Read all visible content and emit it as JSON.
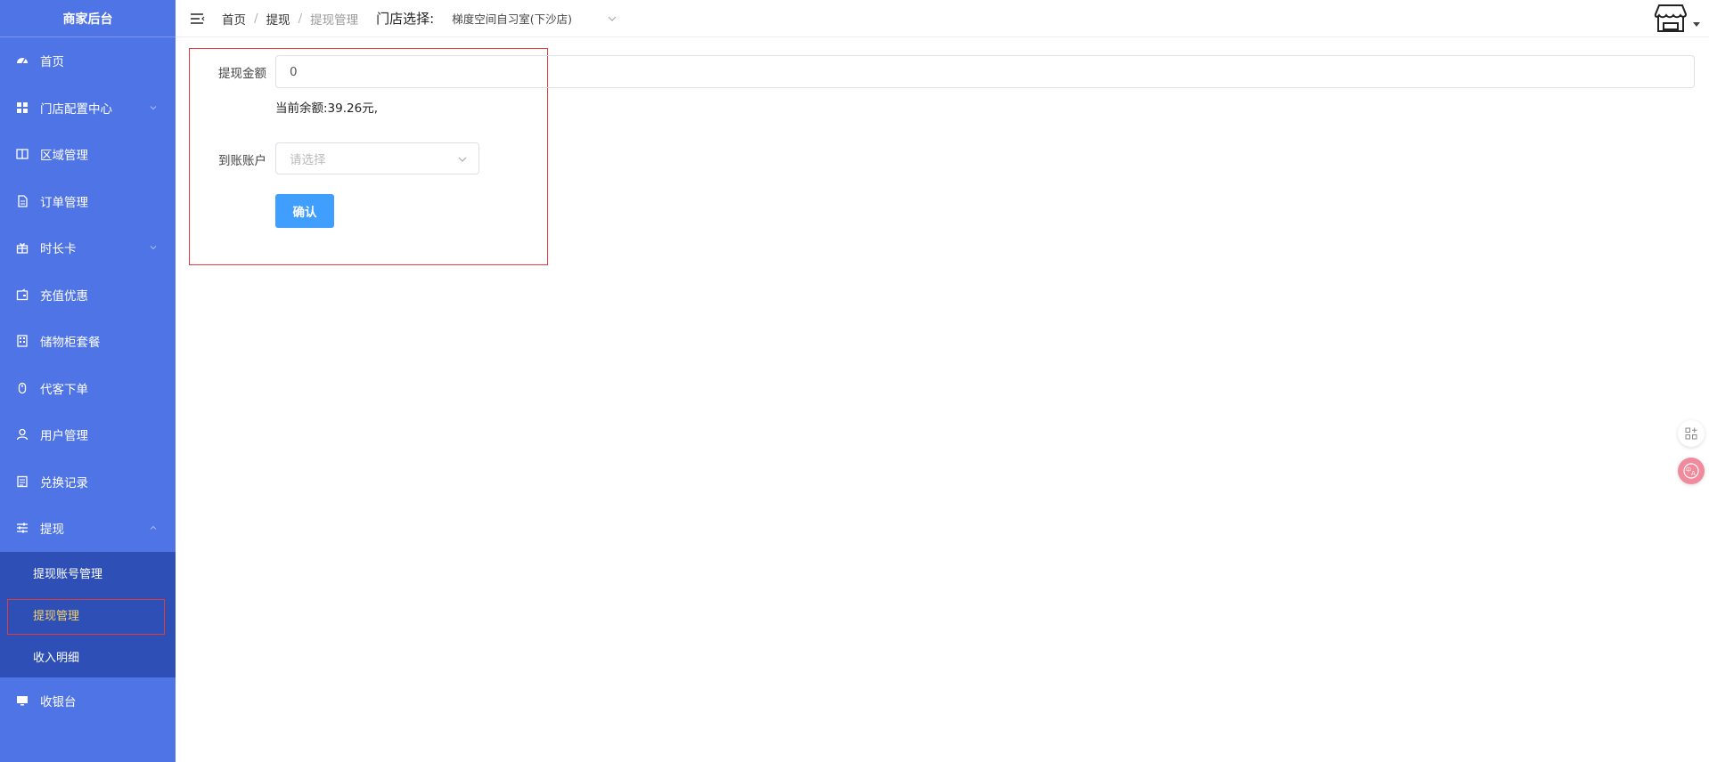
{
  "sidebar": {
    "brand": "商家后台",
    "items": [
      {
        "label": "首页"
      },
      {
        "label": "门店配置中心"
      },
      {
        "label": "区域管理"
      },
      {
        "label": "订单管理"
      },
      {
        "label": "时长卡"
      },
      {
        "label": "充值优惠"
      },
      {
        "label": "储物柜套餐"
      },
      {
        "label": "代客下单"
      },
      {
        "label": "用户管理"
      },
      {
        "label": "兑换记录"
      },
      {
        "label": "提现"
      },
      {
        "label": "收银台"
      }
    ],
    "submenu": [
      {
        "label": "提现账号管理"
      },
      {
        "label": "提现管理"
      },
      {
        "label": "收入明细"
      }
    ]
  },
  "header": {
    "breadcrumb": [
      "首页",
      "提现",
      "提现管理"
    ],
    "separator": "/",
    "store_label": "门店选择:",
    "store_value": "梯度空间自习室(下沙店)"
  },
  "form": {
    "amount_label": "提现金额",
    "amount_value": "0",
    "balance_text": "当前余额:39.26元,",
    "account_label": "到账账户",
    "account_placeholder": "请选择",
    "confirm_label": "确认"
  },
  "colors": {
    "sidebar_bg": "#4f74e6",
    "submenu_bg": "#2d4fb6",
    "active_text": "#f5d36c",
    "primary_button": "#409eff",
    "highlight_border": "#e03c3c"
  }
}
